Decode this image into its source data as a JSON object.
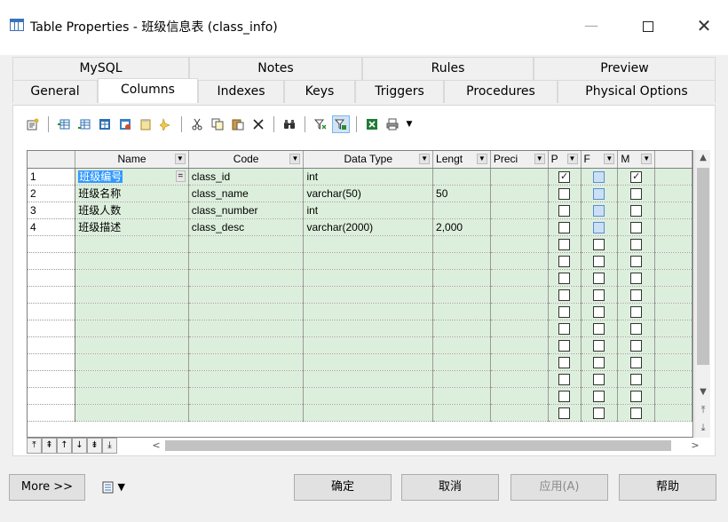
{
  "window": {
    "title": "Table Properties - 班级信息表 (class_info)",
    "min_icon": "minimize-icon",
    "max_icon": "maximize-icon",
    "close_icon": "close-icon"
  },
  "tabs": {
    "row1": [
      "MySQL",
      "Notes",
      "Rules",
      "Preview"
    ],
    "row2": [
      "General",
      "Columns",
      "Indexes",
      "Keys",
      "Triggers",
      "Procedures",
      "Physical Options"
    ],
    "active": "Columns"
  },
  "toolbar": {
    "icons": [
      "properties-icon",
      "insert-row-icon",
      "add-row-icon",
      "add-columns-icon",
      "reuse-columns-icon",
      "clipboard-icon",
      "new-icon",
      "cut-icon",
      "copy-icon",
      "paste-icon",
      "delete-icon",
      "find-icon",
      "filter-icon",
      "customize-columns-icon",
      "excel-export-icon",
      "print-icon",
      "dropdown-icon"
    ]
  },
  "grid": {
    "headers": [
      "Name",
      "Code",
      "Data Type",
      "Lengt",
      "Preci",
      "P",
      "F",
      "M"
    ],
    "rows": [
      {
        "num": "1",
        "name": "班级编号",
        "code": "class_id",
        "type": "int",
        "length": "",
        "precision": "",
        "p": true,
        "f": false,
        "m": true
      },
      {
        "num": "2",
        "name": "班级名称",
        "code": "class_name",
        "type": "varchar(50)",
        "length": "50",
        "precision": "",
        "p": false,
        "f": false,
        "m": false
      },
      {
        "num": "3",
        "name": "班级人数",
        "code": "class_number",
        "type": "int",
        "length": "",
        "precision": "",
        "p": false,
        "f": false,
        "m": false
      },
      {
        "num": "4",
        "name": "班级描述",
        "code": "class_desc",
        "type": "varchar(2000)",
        "length": "2,000",
        "precision": "",
        "p": false,
        "f": false,
        "m": false
      }
    ],
    "empty_rows": 11,
    "eq_button": "="
  },
  "buttons": {
    "more": "More >>",
    "ok": "确定",
    "cancel": "取消",
    "apply": "应用(A)",
    "help": "帮助"
  }
}
